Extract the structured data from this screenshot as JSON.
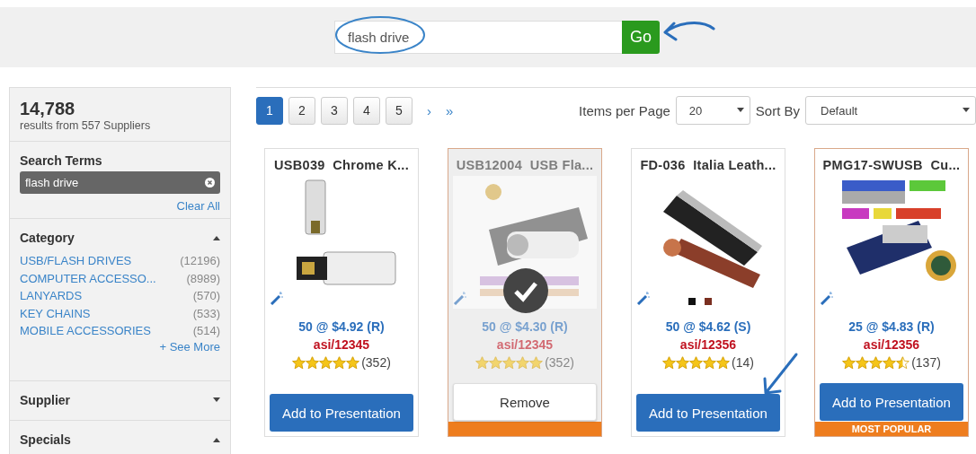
{
  "search": {
    "value": "flash drive",
    "button": "Go"
  },
  "summary": {
    "count": "14,788",
    "detail": "results from 557 Suppliers"
  },
  "search_terms": {
    "title": "Search Terms",
    "chips": [
      {
        "label": "flash drive"
      }
    ],
    "clear": "Clear All"
  },
  "facets": [
    {
      "title": "Category",
      "expanded": true,
      "items": [
        {
          "label": "USB/FLASH DRIVES",
          "count": "(12196)"
        },
        {
          "label": "COMPUTER ACCESSO...",
          "count": "(8989)"
        },
        {
          "label": "LANYARDS",
          "count": "(570)"
        },
        {
          "label": "KEY CHAINS",
          "count": "(533)"
        },
        {
          "label": "MOBILE ACCESSORIES",
          "count": "(514)"
        }
      ],
      "more": "+ See More"
    },
    {
      "title": "Supplier",
      "expanded": false
    },
    {
      "title": "Specials",
      "expanded": true
    }
  ],
  "pagination": {
    "pages": [
      {
        "label": "1",
        "selected": true
      },
      {
        "label": "2",
        "selected": false
      },
      {
        "label": "3",
        "selected": false
      },
      {
        "label": "4",
        "selected": false
      },
      {
        "label": "5",
        "selected": false
      }
    ],
    "next": "›",
    "last": "»"
  },
  "items_per_page": {
    "label": "Items per Page",
    "value": "20"
  },
  "sort_by": {
    "label": "Sort By",
    "value": "Default"
  },
  "products": [
    {
      "title": "USB039  Chrome K...",
      "price": "50 @ $4.92 (R)",
      "asi": "asi/12345",
      "stars": 5,
      "reviews": "(352)",
      "selected": false,
      "popular": false,
      "button": "Add to Presentation"
    },
    {
      "title": "USB12004  USB Fla...",
      "price": "50 @ $4.30 (R)",
      "asi": "asi/12345",
      "stars": 5,
      "reviews": "(352)",
      "selected": true,
      "popular": true,
      "button": "Remove"
    },
    {
      "title": "FD-036  Italia Leath...",
      "price": "50 @ $4.62 (S)",
      "asi": "asi/12356",
      "stars": 5,
      "reviews": "(14)",
      "selected": false,
      "popular": false,
      "button": "Add to Presentation"
    },
    {
      "title": "PMG17-SWUSB  Cu...",
      "price": "25 @ $4.83 (R)",
      "asi": "asi/12356",
      "stars": 4.5,
      "reviews": "(137)",
      "selected": false,
      "popular": true,
      "badge": "MOST POPULAR",
      "button": "Add to Presentation"
    }
  ]
}
